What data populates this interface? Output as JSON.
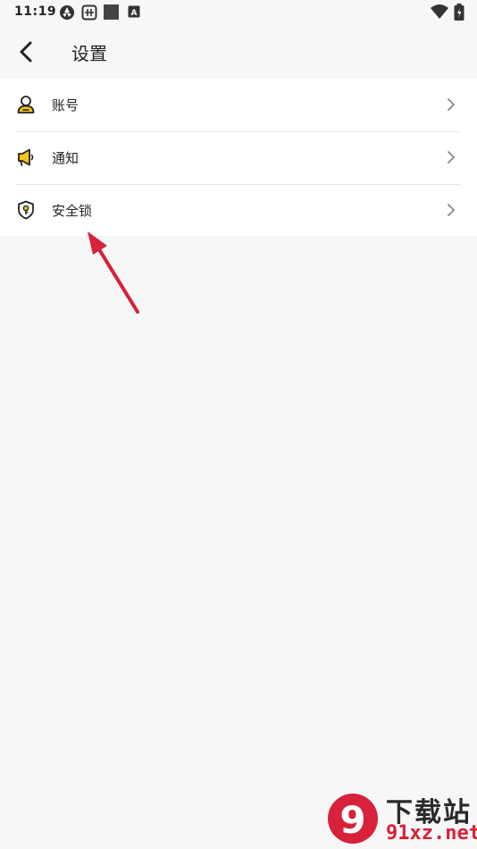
{
  "status_bar": {
    "time": "11:19",
    "left_icons": [
      "aperture-icon",
      "sim-icon",
      "square-icon",
      "keyboard-a-icon"
    ],
    "right_icons": [
      "wifi-icon",
      "battery-icon"
    ],
    "a_glyph": "A"
  },
  "header": {
    "back_icon": "chevron-left-icon",
    "title": "设置"
  },
  "settings_items": [
    {
      "label": "账号",
      "icon": "user-icon",
      "accent": "#f5c518"
    },
    {
      "label": "通知",
      "icon": "megaphone-icon",
      "accent": "#f5c518"
    },
    {
      "label": "安全锁",
      "icon": "shield-lock-icon",
      "accent": "#f5c518"
    }
  ],
  "annotation": {
    "color": "#d8213a"
  },
  "watermark": {
    "line1": "下载站",
    "line2": "91xz.net",
    "logo_glyph": "9"
  },
  "colors": {
    "background": "#f7f7f7",
    "card": "#ffffff",
    "divider": "#e6e6e6",
    "accent_yellow": "#f5c518",
    "brand_red": "#d8213a"
  }
}
